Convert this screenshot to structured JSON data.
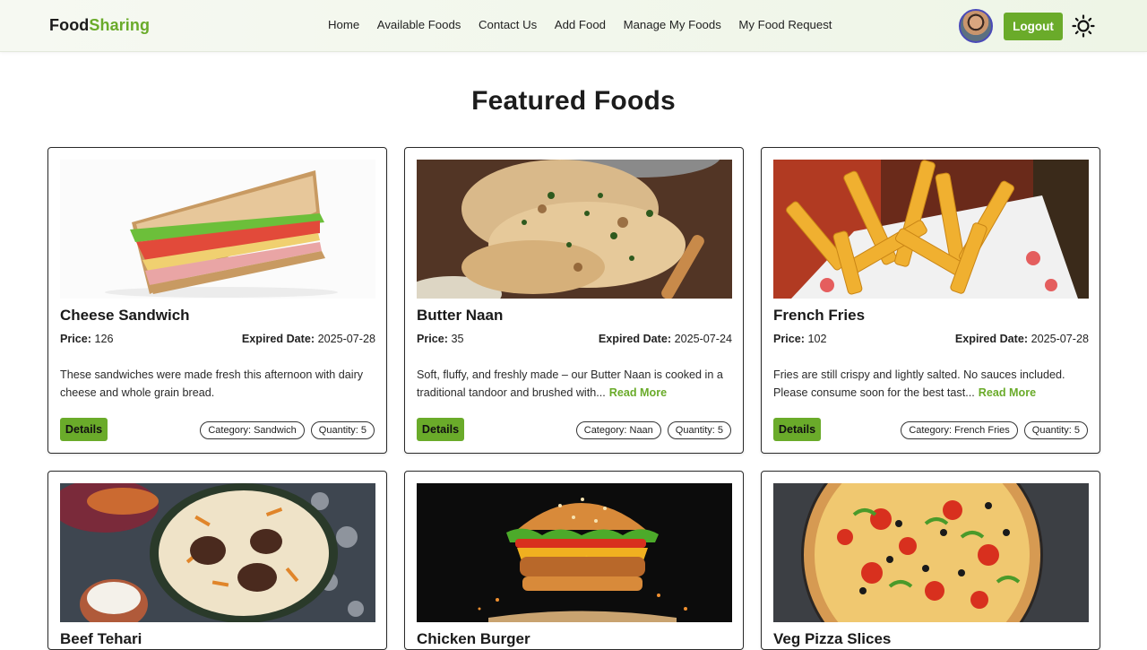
{
  "navbar": {
    "brand_part1": "Food",
    "brand_part2": "Sharing",
    "links": [
      "Home",
      "Available Foods",
      "Contact Us",
      "Add Food",
      "Manage My Foods",
      "My Food Request"
    ],
    "logout_label": "Logout",
    "avatar_icon": "user-avatar-icon",
    "theme_icon": "sun-icon"
  },
  "page_title": "Featured Foods",
  "labels": {
    "price": "Price:",
    "expired": "Expired Date:",
    "details": "Details",
    "read_more": "Read More"
  },
  "foods": [
    {
      "title": "Cheese Sandwich",
      "price": "126",
      "expired_date": "2025-07-28",
      "description": "These sandwiches were made fresh this afternoon with dairy cheese and whole grain bread.",
      "has_read_more": false,
      "category": "Category: Sandwich",
      "quantity": "Quantity: 5",
      "image_icon": "sandwich-image"
    },
    {
      "title": "Butter Naan",
      "price": "35",
      "expired_date": "2025-07-24",
      "description": "Soft, fluffy, and freshly made – our Butter Naan is cooked in a traditional tandoor and brushed with...",
      "has_read_more": true,
      "category": "Category: Naan",
      "quantity": "Quantity: 5",
      "image_icon": "naan-image"
    },
    {
      "title": "French Fries",
      "price": "102",
      "expired_date": "2025-07-28",
      "description": "Fries are still crispy and lightly salted. No sauces included. Please consume soon for the best tast...",
      "has_read_more": true,
      "category": "Category: French Fries",
      "quantity": "Quantity: 5",
      "image_icon": "fries-image"
    },
    {
      "title": "Beef Tehari",
      "image_icon": "tehari-image"
    },
    {
      "title": "Chicken Burger",
      "image_icon": "burger-image"
    },
    {
      "title": "Veg Pizza Slices",
      "image_icon": "pizza-image"
    }
  ],
  "colors": {
    "accent": "#6aab2a",
    "navbar_bg": "#eef5e6",
    "avatar_ring": "#4a4ab8"
  }
}
